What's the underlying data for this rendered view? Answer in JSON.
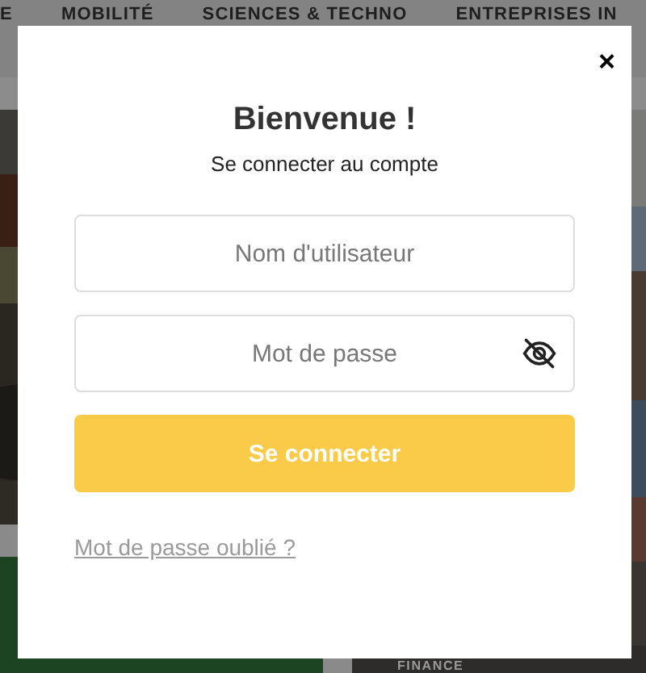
{
  "background_page": {
    "nav_items": [
      "E",
      "MOBILITÉ",
      "SCIENCES & TECHNO",
      "ENTREPRISES IN"
    ],
    "section_label": "FINANCE"
  },
  "login_dialog": {
    "close": "×",
    "title": "Bienvenue !",
    "subtitle": "Se connecter au compte",
    "username_field": {
      "placeholder": "Nom d'utilisateur"
    },
    "password_field": {
      "placeholder": "Mot de passe"
    },
    "submit_button": "Se connecter",
    "forgot_link": "Mot de passe oublié ?"
  }
}
